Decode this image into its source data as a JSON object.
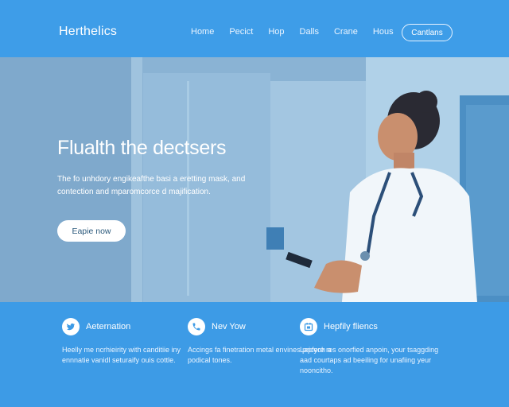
{
  "header": {
    "logo": "Herthelics",
    "nav": [
      "Home",
      "Pecict",
      "Hop",
      "Dalls",
      "Crane",
      "Hous"
    ],
    "cta": "Cantlans"
  },
  "hero": {
    "title": "Flualth the dectsers",
    "subtitle": "The fo unhdory engikeafthe basi a eretting mask, and contection and mparomcorce d majification.",
    "button": "Eapie now"
  },
  "features": [
    {
      "icon": "twitter-bird-icon",
      "title": "Aeternation",
      "desc": "Heelly me ncrhieirity with canditiie iny ennnatie vanidl seturaify ouis cottle."
    },
    {
      "icon": "phone-icon",
      "title": "Nev Yow",
      "desc": "Accings fa finetration metal envines pricyoh a podical tones."
    },
    {
      "icon": "calendar-icon",
      "title": "Hepfily fliencs",
      "desc": "Lapfere res onorfied anpoin, your tsaggding aad courtaps ad beeiling for unafiing yeur nooncitho."
    }
  ],
  "colors": {
    "primary": "#3d9be6",
    "white": "#ffffff",
    "accent": "#2c5a7c"
  }
}
